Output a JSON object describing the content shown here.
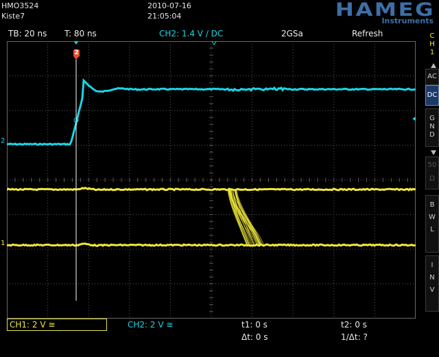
{
  "header": {
    "model": "HMO3524",
    "label": "Kiste7",
    "date": "2010-07-16",
    "time": "21:05:04",
    "logo": "HAMEG",
    "logo_sub": "Instruments",
    "logo_registered": "®"
  },
  "settings_bar": {
    "timebase": "TB: 20 ns",
    "trigger_time": "T: 80 ns",
    "channel_setting": "CH2: 1.4 V ∕ DC",
    "sample_rate": "2GSa",
    "acquisition_mode": "Refresh"
  },
  "side_menu": {
    "channel": [
      "C",
      "H",
      "1"
    ],
    "ac": "AC",
    "dc": "DC",
    "gnd": [
      "G",
      "N",
      "D"
    ],
    "fifty_ohm": [
      "50",
      "Ω"
    ],
    "bwl": [
      "B",
      "W",
      "L"
    ],
    "inv": [
      "I",
      "N",
      "V"
    ]
  },
  "markers": {
    "trigger_marker": "2",
    "ch2_ground": "2",
    "ch1_ground": "1"
  },
  "bottom_bar": {
    "ch1": "CH1: 2 V ≅",
    "ch2": "CH2: 2 V ≅",
    "t1": "t1: 0 s",
    "t2": "t2: 0 s",
    "delta_t": "Δt: 0 s",
    "inv_delta_t": "1/Δt: ?"
  },
  "colors": {
    "ch1": "#f0e83a",
    "ch2": "#19d6e6",
    "grid": "#5a5a5a",
    "logo": "#3d6fa6",
    "trigger_marker": "#e85030",
    "active_button": "#1b3a68"
  }
}
